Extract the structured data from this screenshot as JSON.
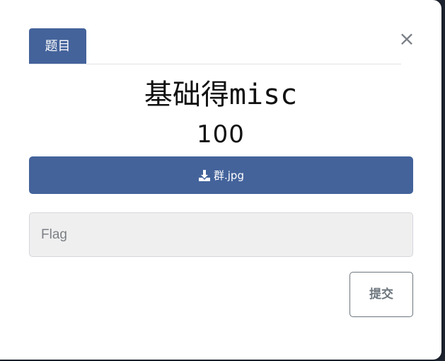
{
  "modal": {
    "tab_label": "题目",
    "close_symbol": "×",
    "challenge_title": "基础得misc",
    "points": "100",
    "download_label": "群.jpg",
    "flag_placeholder": "Flag",
    "flag_value": "",
    "submit_label": "提交"
  },
  "icons": {
    "download": "download-icon",
    "close": "close-icon"
  },
  "colors": {
    "primary": "#44639b",
    "input_bg": "#efefef",
    "secondary_text": "#6c757d",
    "backdrop": "#1e2430"
  }
}
